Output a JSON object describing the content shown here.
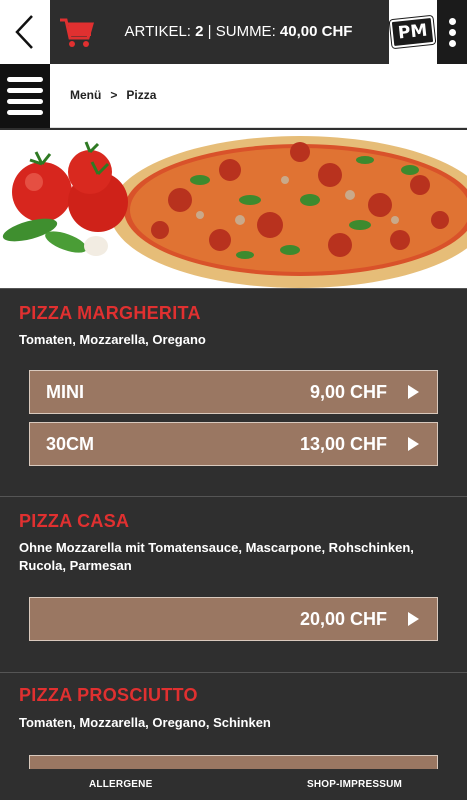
{
  "header": {
    "cart_label": "ARTIKEL:",
    "cart_count": "2",
    "divider": "|",
    "sum_label": "SUMME:",
    "sum_value": "40,00 CHF",
    "logo_text": "PM",
    "icons": [
      "back-chevron-icon",
      "cart-icon",
      "more-vertical-icon",
      "hamburger-menu-icon"
    ],
    "accent_color": "#e03030"
  },
  "breadcrumb": {
    "items": [
      "Menü",
      "Pizza"
    ],
    "separator": ">"
  },
  "products": [
    {
      "title": "PIZZA MARGHERITA",
      "description": "Tomaten, Mozzarella, Oregano",
      "options": [
        {
          "size": "MINI",
          "price": "9,00 CHF"
        },
        {
          "size": "30CM",
          "price": "13,00 CHF"
        }
      ]
    },
    {
      "title": "PIZZA CASA",
      "description": "Ohne Mozzarella mit Tomatensauce, Mascarpone, Rohschinken, Rucola, Parmesan",
      "options": [
        {
          "size": "",
          "price": "20,00 CHF"
        }
      ]
    },
    {
      "title": "PIZZA PROSCIUTTO",
      "description": "Tomaten, Mozzarella, Oregano, Schinken",
      "options": []
    }
  ],
  "footer": {
    "allergens": "ALLERGENE",
    "imprint": "SHOP-IMPRESSUM"
  },
  "colors": {
    "background": "#2f2f2f",
    "button": "#9a7762",
    "title": "#e03030"
  }
}
